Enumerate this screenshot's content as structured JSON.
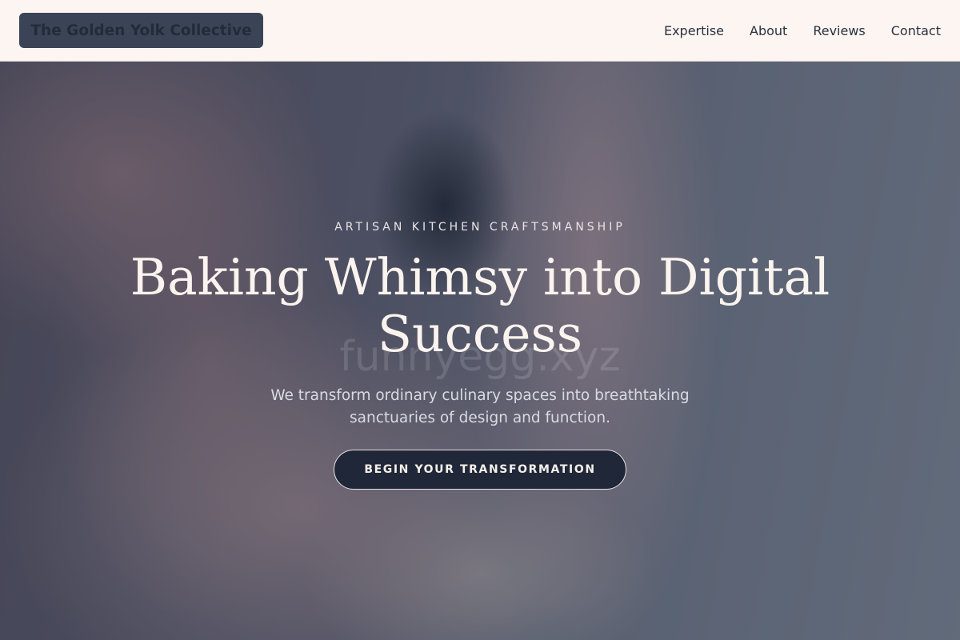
{
  "header": {
    "brand": "The Golden Yolk Collective",
    "nav": [
      {
        "label": "Expertise"
      },
      {
        "label": "About"
      },
      {
        "label": "Reviews"
      },
      {
        "label": "Contact"
      }
    ]
  },
  "hero": {
    "eyebrow": "ARTISAN KITCHEN CRAFTSMANSHIP",
    "headline": "Baking Whimsy into Digital Success",
    "watermark": "funnyegg.xyz",
    "subtext": "We transform ordinary culinary spaces into breathtaking sanctuaries of design and function.",
    "cta": "BEGIN YOUR TRANSFORMATION"
  },
  "colors": {
    "header_bg": "#fdf5f1",
    "brand_bg": "#3a4456",
    "cta_bg": "#1f2738",
    "headline": "#fbf3ee"
  }
}
